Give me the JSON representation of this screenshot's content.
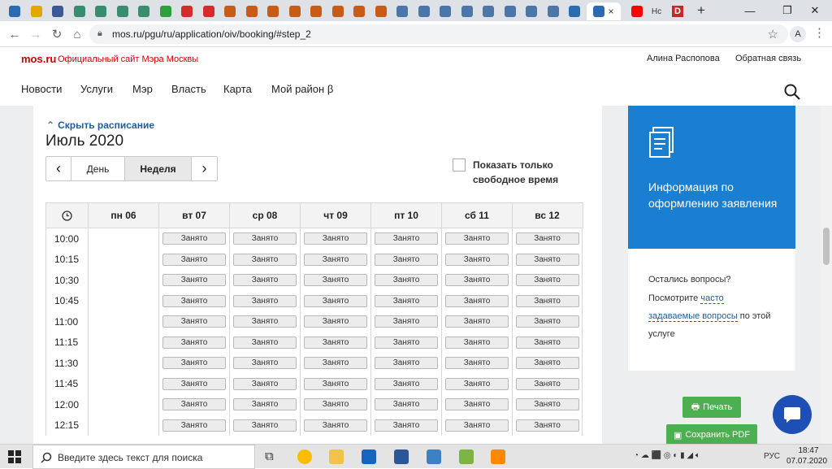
{
  "browser": {
    "tab_favicon_colors": [
      "#2b6cb0",
      "#e0a800",
      "#3b5998",
      "#3a8c6e",
      "#3a8c6e",
      "#3a8c6e",
      "#3a8c6e",
      "#2e9e3e",
      "#d62b2b",
      "#d62b2b",
      "#c75b18",
      "#c75b18",
      "#c75b18",
      "#c75b18",
      "#c75b18",
      "#c75b18",
      "#c75b18",
      "#c75b18",
      "#4a76a8",
      "#4a76a8",
      "#4a76a8",
      "#4a76a8",
      "#4a76a8",
      "#4a76a8",
      "#4a76a8",
      "#4a76a8",
      "#2b6cb0"
    ],
    "active_tab_close": "×",
    "youtube_tab_color": "#ff0000",
    "hc_tab_label": "Hc",
    "d_tab_label": "D",
    "new_tab": "+",
    "url": "mos.ru/pgu/ru/application/oiv/booking/#step_2",
    "profile_initial": "A"
  },
  "site": {
    "logo": "mos.ru",
    "tagline": "Официальный сайт Мэра Москвы",
    "user_name": "Алина Распопова",
    "feedback": "Обратная связь",
    "nav": [
      "Новости",
      "Услуги",
      "Мэр",
      "Власть",
      "Карта",
      "Мой район β"
    ]
  },
  "schedule": {
    "hide_link": "Скрыть расписание",
    "month": "Июль 2020",
    "prev": "‹",
    "next": "›",
    "view_day": "День",
    "view_week": "Неделя",
    "free_only_label": "Показать только свободное время",
    "days": [
      "пн 06",
      "вт 07",
      "ср 08",
      "чт 09",
      "пт 10",
      "сб 11",
      "вс 12"
    ],
    "times": [
      "10:00",
      "10:15",
      "10:30",
      "10:45",
      "11:00",
      "11:15",
      "11:30",
      "11:45",
      "12:00",
      "12:15"
    ],
    "busy_label": "Занято"
  },
  "sidebar": {
    "info_title": "Информация по оформлению заявления",
    "q_line1": "Остались вопросы?",
    "q_line2_pre": "Посмотрите ",
    "q_link1": "часто",
    "q_link2": "задаваемые вопросы",
    "q_line3_post": " по этой",
    "q_line4": "услуге",
    "print": "Печать",
    "save_pdf": "Сохранить PDF"
  },
  "taskbar": {
    "search_placeholder": "Введите здесь текст для поиска",
    "lang": "РУС",
    "time": "18:47",
    "date": "07.07.2020"
  }
}
